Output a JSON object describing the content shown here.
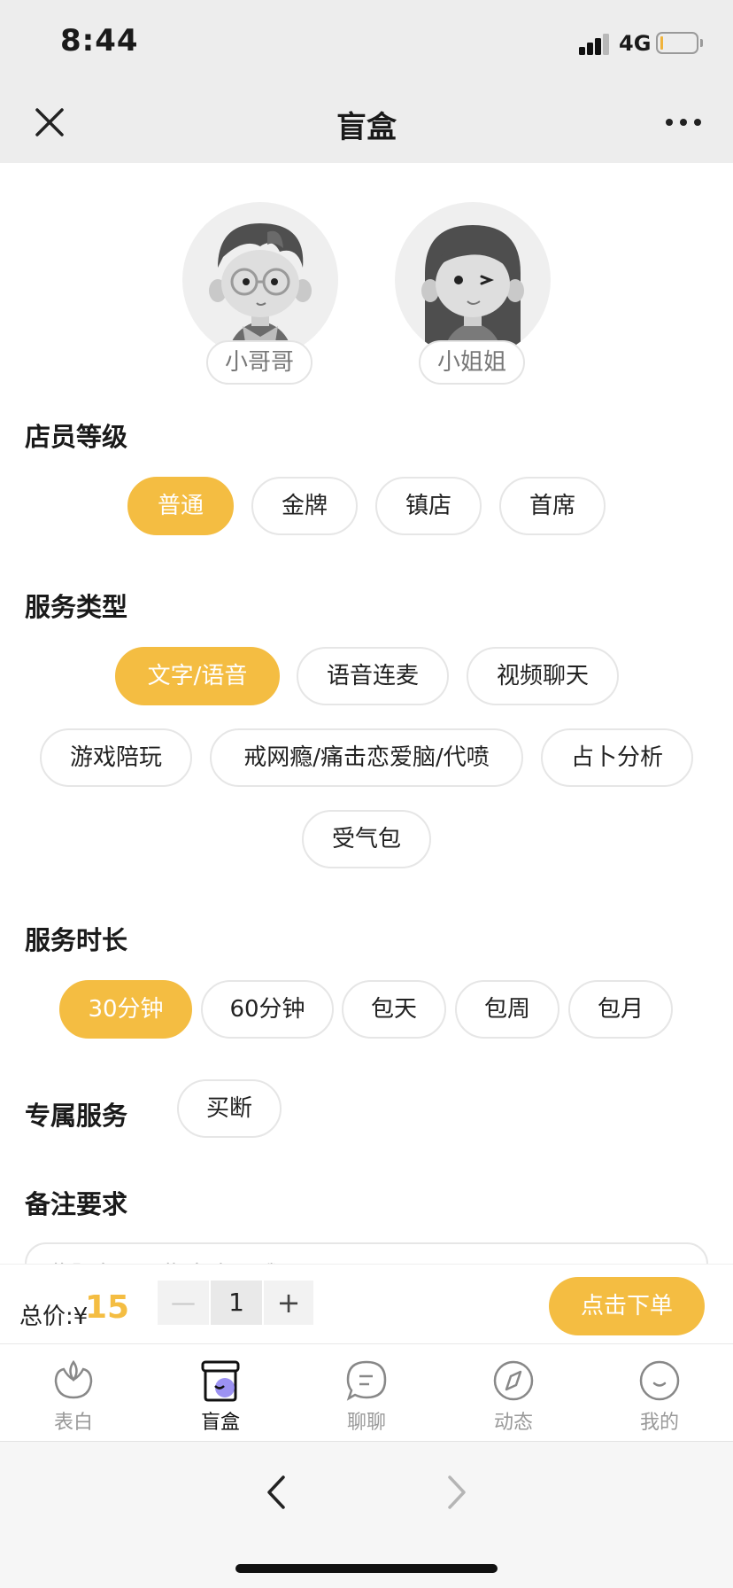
{
  "status_bar": {
    "time": "8:44",
    "network": "4G"
  },
  "nav": {
    "title": "盲盒",
    "close_icon": "close-icon",
    "more_icon": "more-icon"
  },
  "avatars": [
    {
      "label": "小哥哥",
      "icon": "male-avatar-icon"
    },
    {
      "label": "小姐姐",
      "icon": "female-avatar-icon"
    }
  ],
  "level": {
    "title": "店员等级",
    "options": [
      "普通",
      "金牌",
      "镇店",
      "首席"
    ],
    "selected": "普通"
  },
  "service_type": {
    "title": "服务类型",
    "options": [
      "文字/语音",
      "语音连麦",
      "视频聊天",
      "游戏陪玩",
      "戒网瘾/痛击恋爱脑/代喷",
      "占卜分析",
      "受气包"
    ],
    "selected": "文字/语音"
  },
  "duration": {
    "title": "服务时长",
    "options": [
      "30分钟",
      "60分钟",
      "包天",
      "包周",
      "包月"
    ],
    "selected": "30分钟"
  },
  "exclusive": {
    "title": "专属服务",
    "option": "买断"
  },
  "remarks": {
    "title": "备注要求",
    "placeholder": "此服务不可指定店员哦"
  },
  "order": {
    "total_label": "总价:¥",
    "total_value": "15",
    "minus": "—",
    "quantity": "1",
    "plus": "+",
    "submit_label": "点击下单"
  },
  "tabs": [
    {
      "label": "表白",
      "icon": "flower-icon",
      "active": false
    },
    {
      "label": "盲盒",
      "icon": "box-icon",
      "active": true
    },
    {
      "label": "聊聊",
      "icon": "chat-icon",
      "active": false
    },
    {
      "label": "动态",
      "icon": "compass-icon",
      "active": false
    },
    {
      "label": "我的",
      "icon": "smile-icon",
      "active": false
    }
  ],
  "colors": {
    "accent": "#f4bd42",
    "nav_bg": "#ededed"
  }
}
